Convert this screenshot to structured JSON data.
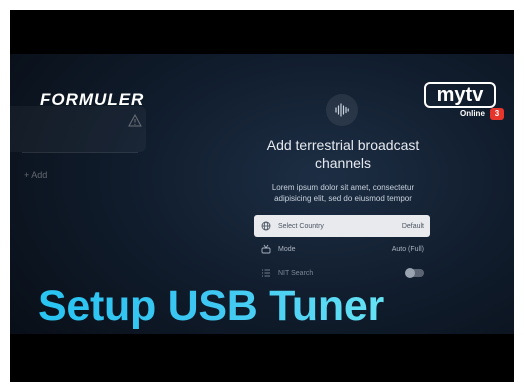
{
  "brand": {
    "name": "FORMULER"
  },
  "mytv": {
    "logo": "mytv",
    "subtitle": "Online",
    "version": "3"
  },
  "left_panel": {
    "add_label": "+ Add"
  },
  "dialog": {
    "title": "Add terrestrial broadcast channels",
    "description": "Lorem ipsum dolor sit amet, consectetur adipisicing elit, sed do eiusmod tempor",
    "rows": [
      {
        "label": "Select Country",
        "value": "Default",
        "icon": "globe-icon"
      },
      {
        "label": "Mode",
        "value": "Auto (Full)",
        "icon": "antenna-icon"
      },
      {
        "label": "NIT Search",
        "icon": "list-icon",
        "toggle": "off"
      }
    ]
  },
  "overlay": {
    "headline": "Setup USB Tuner"
  },
  "colors": {
    "headline_start": "#28c4f2",
    "headline_end": "#66e3f5",
    "badge": "#e6352b"
  }
}
